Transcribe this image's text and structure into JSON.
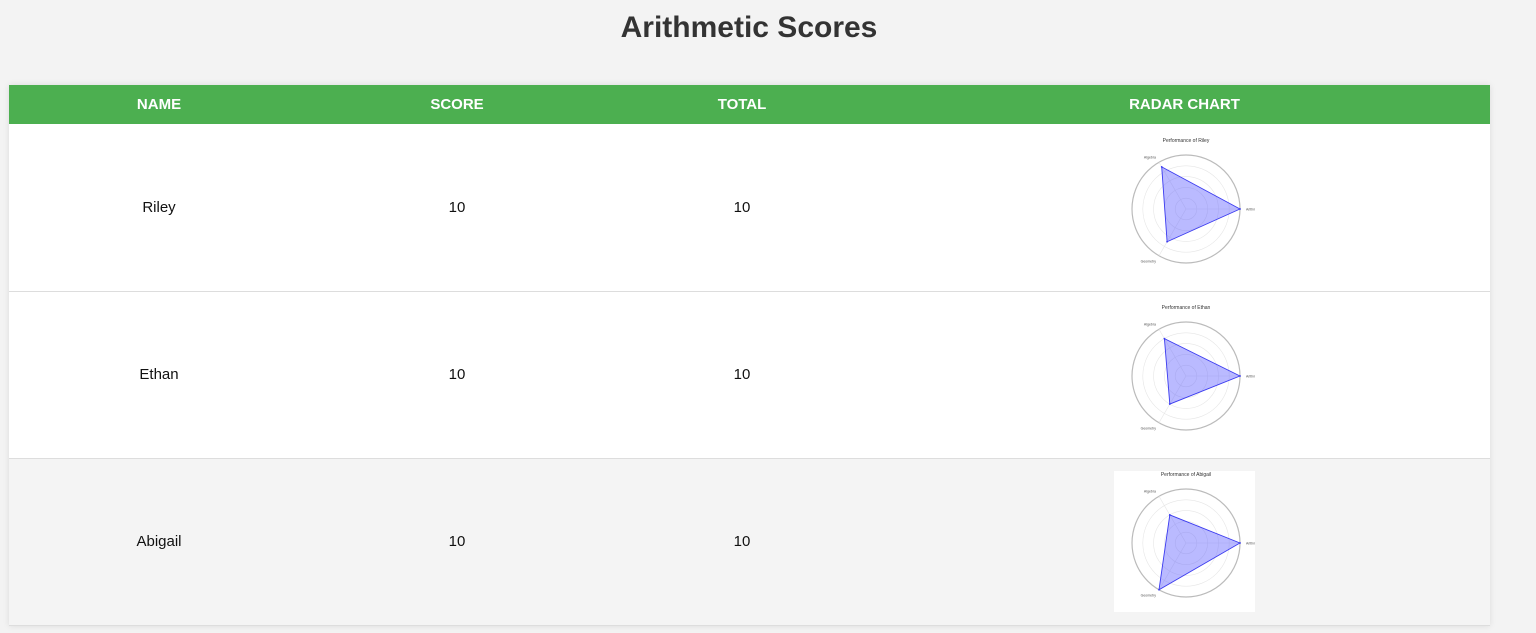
{
  "page": {
    "title": "Arithmetic Scores"
  },
  "table": {
    "headers": {
      "name": "NAME",
      "score": "SCORE",
      "total": "TOTAL",
      "radar": "RADAR CHART"
    },
    "rows": [
      {
        "name": "Riley",
        "score": "10",
        "total": "10",
        "shaded": false
      },
      {
        "name": "Ethan",
        "score": "10",
        "total": "10",
        "shaded": false
      },
      {
        "name": "Abigail",
        "score": "10",
        "total": "10",
        "shaded": true
      }
    ]
  },
  "chart_data": [
    {
      "type": "radar",
      "title": "Performance of Riley",
      "categories": [
        "Arithmetic",
        "Algebra",
        "Geometry"
      ],
      "values": [
        1.0,
        0.9,
        0.7
      ],
      "ylim": [
        0,
        1
      ],
      "color": "#6666ff"
    },
    {
      "type": "radar",
      "title": "Performance of Ethan",
      "categories": [
        "Arithmetic",
        "Algebra",
        "Geometry"
      ],
      "values": [
        1.0,
        0.8,
        0.6
      ],
      "ylim": [
        0,
        1
      ],
      "color": "#6666ff"
    },
    {
      "type": "radar",
      "title": "Performance of Abigail",
      "categories": [
        "Arithmetic",
        "Algebra",
        "Geometry"
      ],
      "values": [
        1.0,
        0.6,
        1.0
      ],
      "ylim": [
        0,
        1
      ],
      "color": "#6666ff"
    }
  ]
}
